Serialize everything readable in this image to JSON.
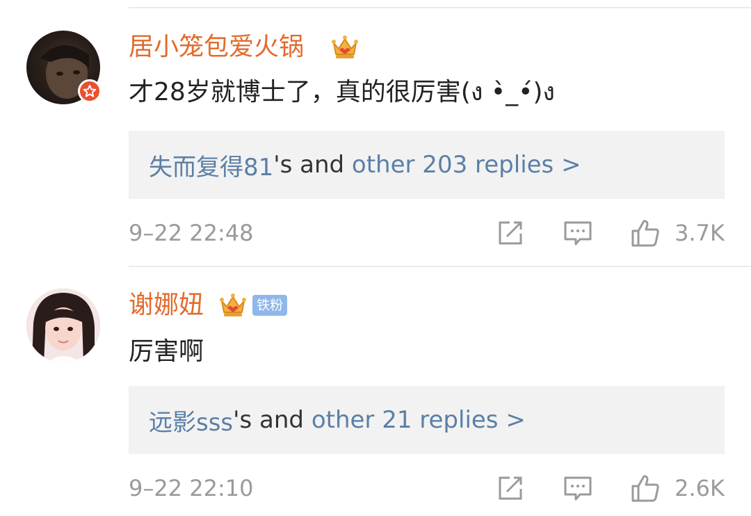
{
  "comments": [
    {
      "username": "居小笼包爱火锅",
      "avatar_icon": "user-avatar",
      "verified_icon": "verified-star-icon",
      "crown_icon": "crown-icon",
      "text": "才28岁就博士了，真的很厉害(ง •̀_•́)ง",
      "replies": {
        "first": "失而复得81",
        "middle": "'s and ",
        "rest": "other 203 replies >"
      },
      "time": "9–22 22:48",
      "likes": "3.7K"
    },
    {
      "username": "谢娜妞",
      "avatar_icon": "user-avatar",
      "crown_icon": "crown-icon",
      "badge": "铁粉",
      "text": "厉害啊",
      "replies": {
        "first": "远影sss",
        "middle": "'s and ",
        "rest": "other 21 replies >"
      },
      "time": "9–22 22:10",
      "likes": "2.6K"
    }
  ],
  "colors": {
    "username": "#e36a2c",
    "link": "#5b7fa6",
    "meta": "#9a9a9a",
    "reply_bg": "#f2f2f2",
    "fan_badge": "#8fb7e9",
    "verified": "#ea4f2f"
  }
}
